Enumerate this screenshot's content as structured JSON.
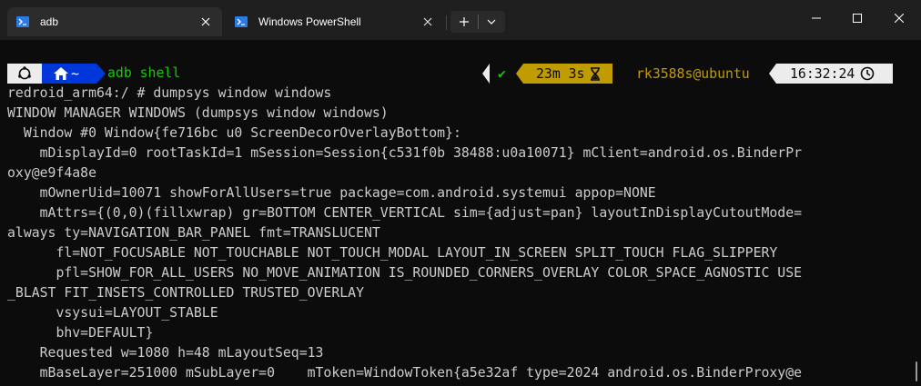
{
  "tabs": [
    {
      "label": "adb",
      "active": true
    },
    {
      "label": "Windows PowerShell",
      "active": false
    }
  ],
  "prompt": {
    "command": "adb shell",
    "home_symbol": "~",
    "status_ok": "✔",
    "duration": "23m 3s",
    "user_host": "rk3588s@ubuntu",
    "clock": "16:32:24"
  },
  "output_lines": [
    "redroid_arm64:/ # dumpsys window windows",
    "WINDOW MANAGER WINDOWS (dumpsys window windows)",
    "  Window #0 Window{fe716bc u0 ScreenDecorOverlayBottom}:",
    "    mDisplayId=0 rootTaskId=1 mSession=Session{c531f0b 38488:u0a10071} mClient=android.os.BinderPr",
    "oxy@e9f4a8e",
    "    mOwnerUid=10071 showForAllUsers=true package=com.android.systemui appop=NONE",
    "    mAttrs={(0,0)(fillxwrap) gr=BOTTOM CENTER_VERTICAL sim={adjust=pan} layoutInDisplayCutoutMode=",
    "always ty=NAVIGATION_BAR_PANEL fmt=TRANSLUCENT",
    "      fl=NOT_FOCUSABLE NOT_TOUCHABLE NOT_TOUCH_MODAL LAYOUT_IN_SCREEN SPLIT_TOUCH FLAG_SLIPPERY",
    "      pfl=SHOW_FOR_ALL_USERS NO_MOVE_ANIMATION IS_ROUNDED_CORNERS_OVERLAY COLOR_SPACE_AGNOSTIC USE",
    "_BLAST FIT_INSETS_CONTROLLED TRUSTED_OVERLAY",
    "      vsysui=LAYOUT_STABLE",
    "      bhv=DEFAULT}",
    "    Requested w=1080 h=48 mLayoutSeq=13",
    "    mBaseLayer=251000 mSubLayer=0    mToken=WindowToken{a5e32af type=2024 android.os.BinderProxy@e"
  ],
  "colors": {
    "background": "#0c0c0c",
    "foreground": "#cccccc",
    "prompt_green": "#16c60c",
    "home_blue": "#0037da",
    "duration_yellow": "#c19c00",
    "user_yellow": "#c19c00",
    "clock_bg": "#ececec"
  },
  "icons": {
    "tab_icon": "powershell-icon",
    "close": "close-icon",
    "new_tab": "plus-icon",
    "dropdown": "chevron-down-icon",
    "os": "ubuntu-icon",
    "home": "home-icon",
    "hourglass": "hourglass-icon",
    "clock": "clock-icon"
  }
}
